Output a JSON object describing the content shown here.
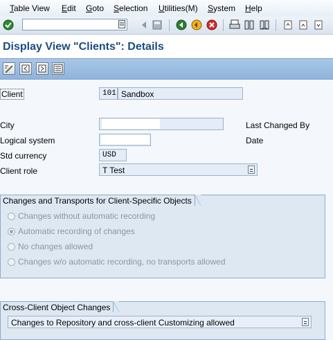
{
  "menu": [
    "Table View",
    "Edit",
    "Goto",
    "Selection",
    "Utilities(M)",
    "System",
    "Help"
  ],
  "toolbar": {
    "command_value": ""
  },
  "title": "Display View \"Clients\": Details",
  "form": {
    "client_label": "Client",
    "client_number": "101",
    "client_name": "Sandbox",
    "city_label": "City",
    "city_value": "",
    "last_changed_by_label": "Last Changed By",
    "logical_system_label": "Logical system",
    "logical_system_value": "",
    "date_label": "Date",
    "currency_label": "Std currency",
    "currency_value": "USD",
    "client_role_label": "Client role",
    "client_role_value": "T Test"
  },
  "changes_group": {
    "title": "Changes and Transports for Client-Specific Objects",
    "options": [
      {
        "label": "Changes without automatic recording",
        "selected": false
      },
      {
        "label": "Automatic recording of changes",
        "selected": true
      },
      {
        "label": "No changes allowed",
        "selected": false
      },
      {
        "label": "Changes w/o automatic recording, no transports allowed",
        "selected": false
      }
    ]
  },
  "cross_client_group": {
    "title": "Cross-Client Object Changes",
    "value": "Changes to Repository and cross-client Customizing allowed"
  },
  "colors": {
    "title": "#1e4b82",
    "app_toolbar": "#9bbde2",
    "group_bg": "#dde8f3"
  }
}
